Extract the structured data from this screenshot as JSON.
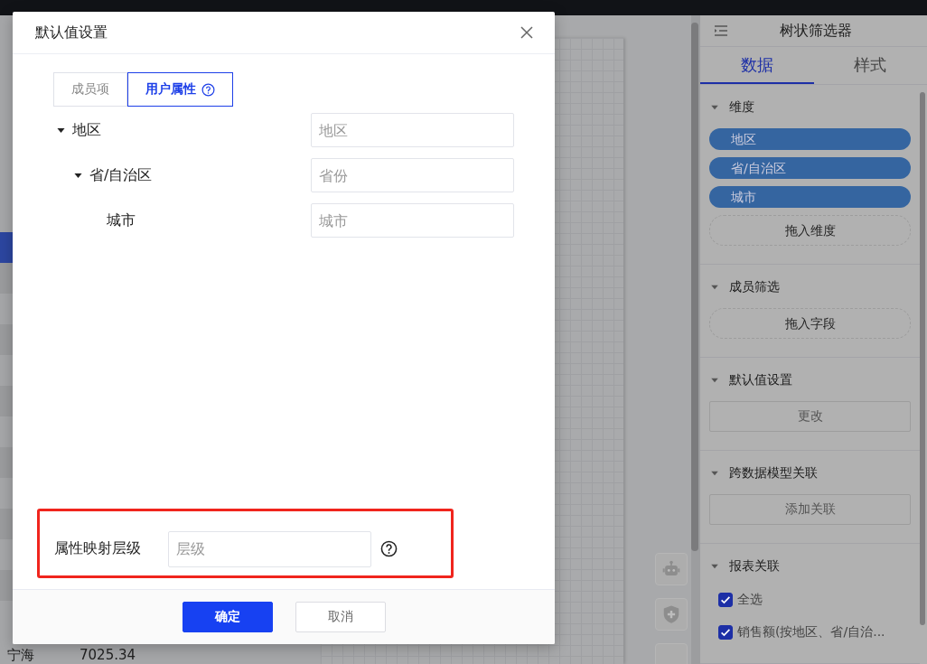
{
  "background_table": {
    "rows": [
      {
        "column_1": "宁海",
        "column_2": "7025.34"
      }
    ]
  },
  "panel": {
    "title": "树状筛选器",
    "tabs": [
      {
        "label": "数据",
        "selected": true
      },
      {
        "label": "样式",
        "selected": false
      }
    ],
    "sections": [
      {
        "kind": "pills",
        "title": "维度",
        "expanded": true,
        "items": [
          "地区",
          "省/自治区",
          "城市"
        ],
        "drop_hint": "拖入维度"
      },
      {
        "kind": "drop",
        "title": "成员筛选",
        "expanded": true,
        "drop_hint": "拖入字段"
      },
      {
        "kind": "button",
        "title": "默认值设置",
        "expanded": true,
        "button": "更改"
      },
      {
        "kind": "button",
        "title": "跨数据模型关联",
        "expanded": true,
        "button": "添加关联"
      },
      {
        "kind": "checklist",
        "title": "报表关联",
        "expanded": true,
        "items": [
          {
            "label": "全选",
            "checked": true
          },
          {
            "label": "销售额(按地区、省/自治...",
            "checked": true
          }
        ]
      }
    ]
  },
  "dialog": {
    "title": "默认值设置",
    "tabs": [
      {
        "label": "成员项",
        "selected": false,
        "help": false
      },
      {
        "label": "用户属性",
        "selected": true,
        "help": true
      }
    ],
    "tree": [
      {
        "label": "地区",
        "placeholder": "地区",
        "expanded": true,
        "children": [
          {
            "label": "省/自治区",
            "placeholder": "省份",
            "expanded": true,
            "children": [
              {
                "label": "城市",
                "placeholder": "城市"
              }
            ]
          }
        ]
      }
    ],
    "mapping": {
      "label": "属性映射层级",
      "placeholder": "层级",
      "highlighted": true,
      "help": true
    },
    "buttons": [
      {
        "label": "确定",
        "kind": "primary"
      },
      {
        "label": "取消",
        "kind": "default"
      }
    ]
  }
}
